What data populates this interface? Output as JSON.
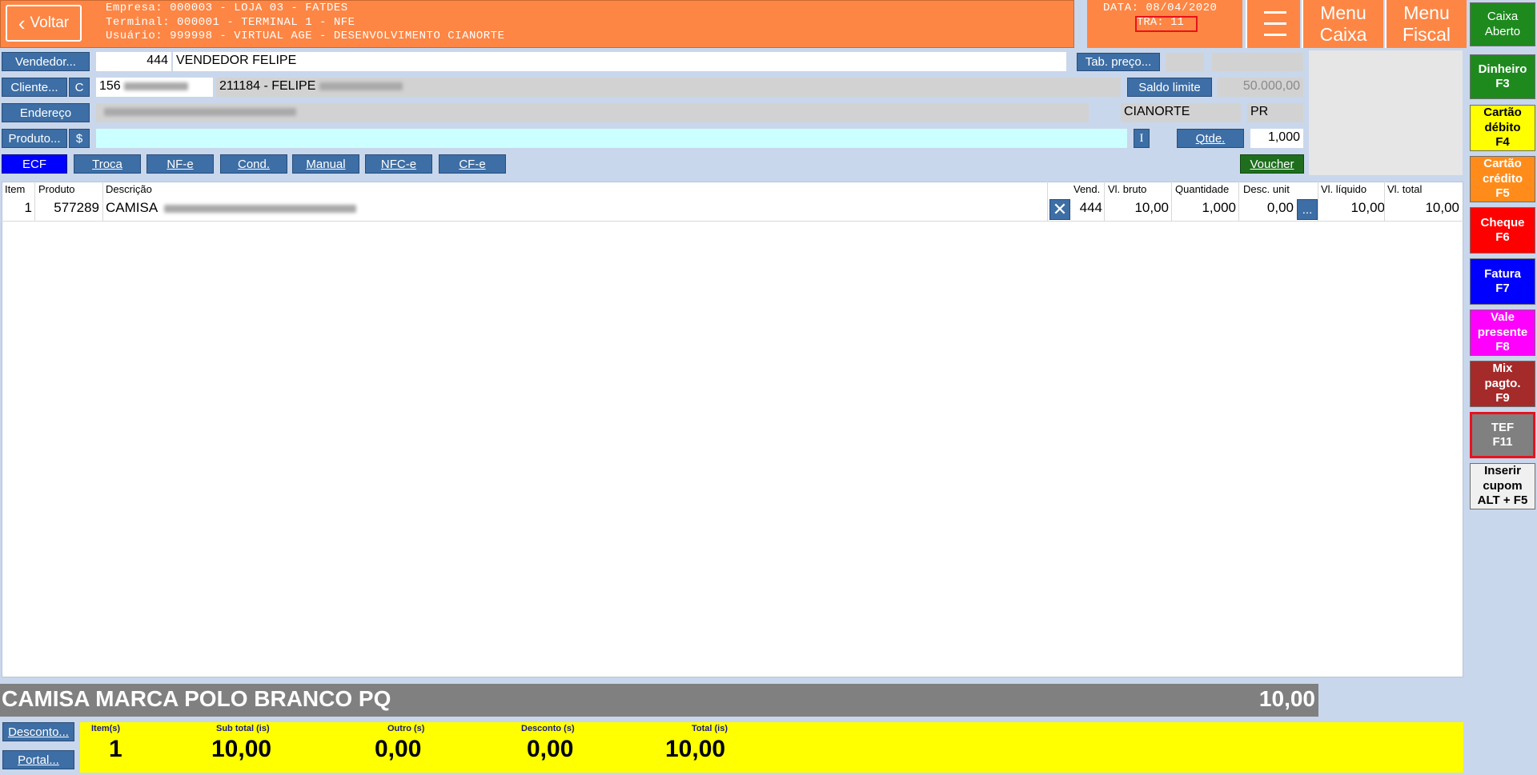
{
  "header": {
    "back_label": "Voltar",
    "empresa": "Empresa: 000003 - LOJA 03 - FATDES",
    "terminal": "Terminal: 000001 - TERMINAL 1 - NFE",
    "usuario": "Usuário: 999998 - VIRTUAL AGE - DESENVOLVIMENTO CIANORTE",
    "data": "DATA: 08/04/2020",
    "tra": "TRA: 11",
    "menu_caixa_1": "Menu",
    "menu_caixa_2": "Caixa",
    "menu_fiscal_1": "Menu",
    "menu_fiscal_2": "Fiscal"
  },
  "status": {
    "caixa_1": "Caixa",
    "caixa_2": "Aberto"
  },
  "payments": [
    {
      "l1": "Dinheiro",
      "l2": "F3",
      "l3": "",
      "bg": "#1e8a1e",
      "fg": "#ffffff"
    },
    {
      "l1": "Cartão",
      "l2": "débito",
      "l3": "F4",
      "bg": "#ffff00",
      "fg": "#000000"
    },
    {
      "l1": "Cartão",
      "l2": "crédito",
      "l3": "F5",
      "bg": "#ff8c1a",
      "fg": "#ffffff"
    },
    {
      "l1": "Cheque",
      "l2": "F6",
      "l3": "",
      "bg": "#ff0000",
      "fg": "#ffffff"
    },
    {
      "l1": "Fatura",
      "l2": "F7",
      "l3": "",
      "bg": "#0000ff",
      "fg": "#ffffff"
    },
    {
      "l1": "Vale",
      "l2": "presente",
      "l3": "F8",
      "bg": "#ff00ff",
      "fg": "#ffffff"
    },
    {
      "l1": "Mix",
      "l2": "pagto.",
      "l3": "F9",
      "bg": "#a52a2a",
      "fg": "#ffffff"
    },
    {
      "l1": "TEF",
      "l2": "F11",
      "l3": "",
      "bg": "#808080",
      "fg": "#ffffff"
    },
    {
      "l1": "Inserir",
      "l2": "cupom",
      "l3": "ALT + F5",
      "bg": "#f0f0f0",
      "fg": "#000000"
    }
  ],
  "form": {
    "vendedor_btn": "Vendedor...",
    "vendedor_code": "444",
    "vendedor_name": "VENDEDOR FELIPE",
    "tab_preco_btn": "Tab. preço...",
    "cliente_btn": "Cliente...",
    "cliente_c_btn": "C",
    "cliente_code": "156",
    "cliente_name": "211184 - FELIPE",
    "saldo_limite_btn": "Saldo limite",
    "saldo_limite_value": "50.000,00",
    "endereco_btn": "Endereço",
    "cidade": "CIANORTE",
    "uf": "PR",
    "produto_btn": "Produto...",
    "produto_dollar_btn": "$",
    "i_btn": "I",
    "qtde_btn": "Qtde.",
    "qtde_value": "1,000",
    "voucher_btn": "Voucher"
  },
  "doc_tabs": [
    "ECF",
    "Troca",
    "NF-e",
    "Cond.",
    "Manual",
    "NFC-e",
    "CF-e"
  ],
  "grid": {
    "headers": [
      "Item",
      "Produto",
      "Descrição",
      "Vend.",
      "Vl. bruto",
      "Quantidade",
      "Desc. unit",
      "Vl. líquido",
      "Vl. total"
    ],
    "rows": [
      {
        "item": "1",
        "produto": "577289",
        "descricao": "CAMISA",
        "vend": "444",
        "vl_bruto": "10,00",
        "quantidade": "1,000",
        "desc_unit": "0,00",
        "more": "...",
        "vl_liquido": "10,00",
        "vl_total": "10,00"
      }
    ]
  },
  "banner": {
    "product": "CAMISA MARCA POLO BRANCO PQ",
    "value": "10,00"
  },
  "bottom": {
    "desconto_btn": "Desconto...",
    "portal_btn": "Portal...",
    "totals": [
      {
        "label": "Item(s)",
        "value": "1"
      },
      {
        "label": "Sub total (is)",
        "value": "10,00"
      },
      {
        "label": "Outro (s)",
        "value": "0,00"
      },
      {
        "label": "Desconto (s)",
        "value": "0,00"
      },
      {
        "label": "Total (is)",
        "value": "10,00"
      }
    ]
  },
  "colors": {
    "header_orange": "#fd8645",
    "form_blue": "#3d6ea5",
    "ecf_active": "#0000ff",
    "totals_yellow": "#ffff00",
    "voucher_green": "#1e6e1e"
  }
}
